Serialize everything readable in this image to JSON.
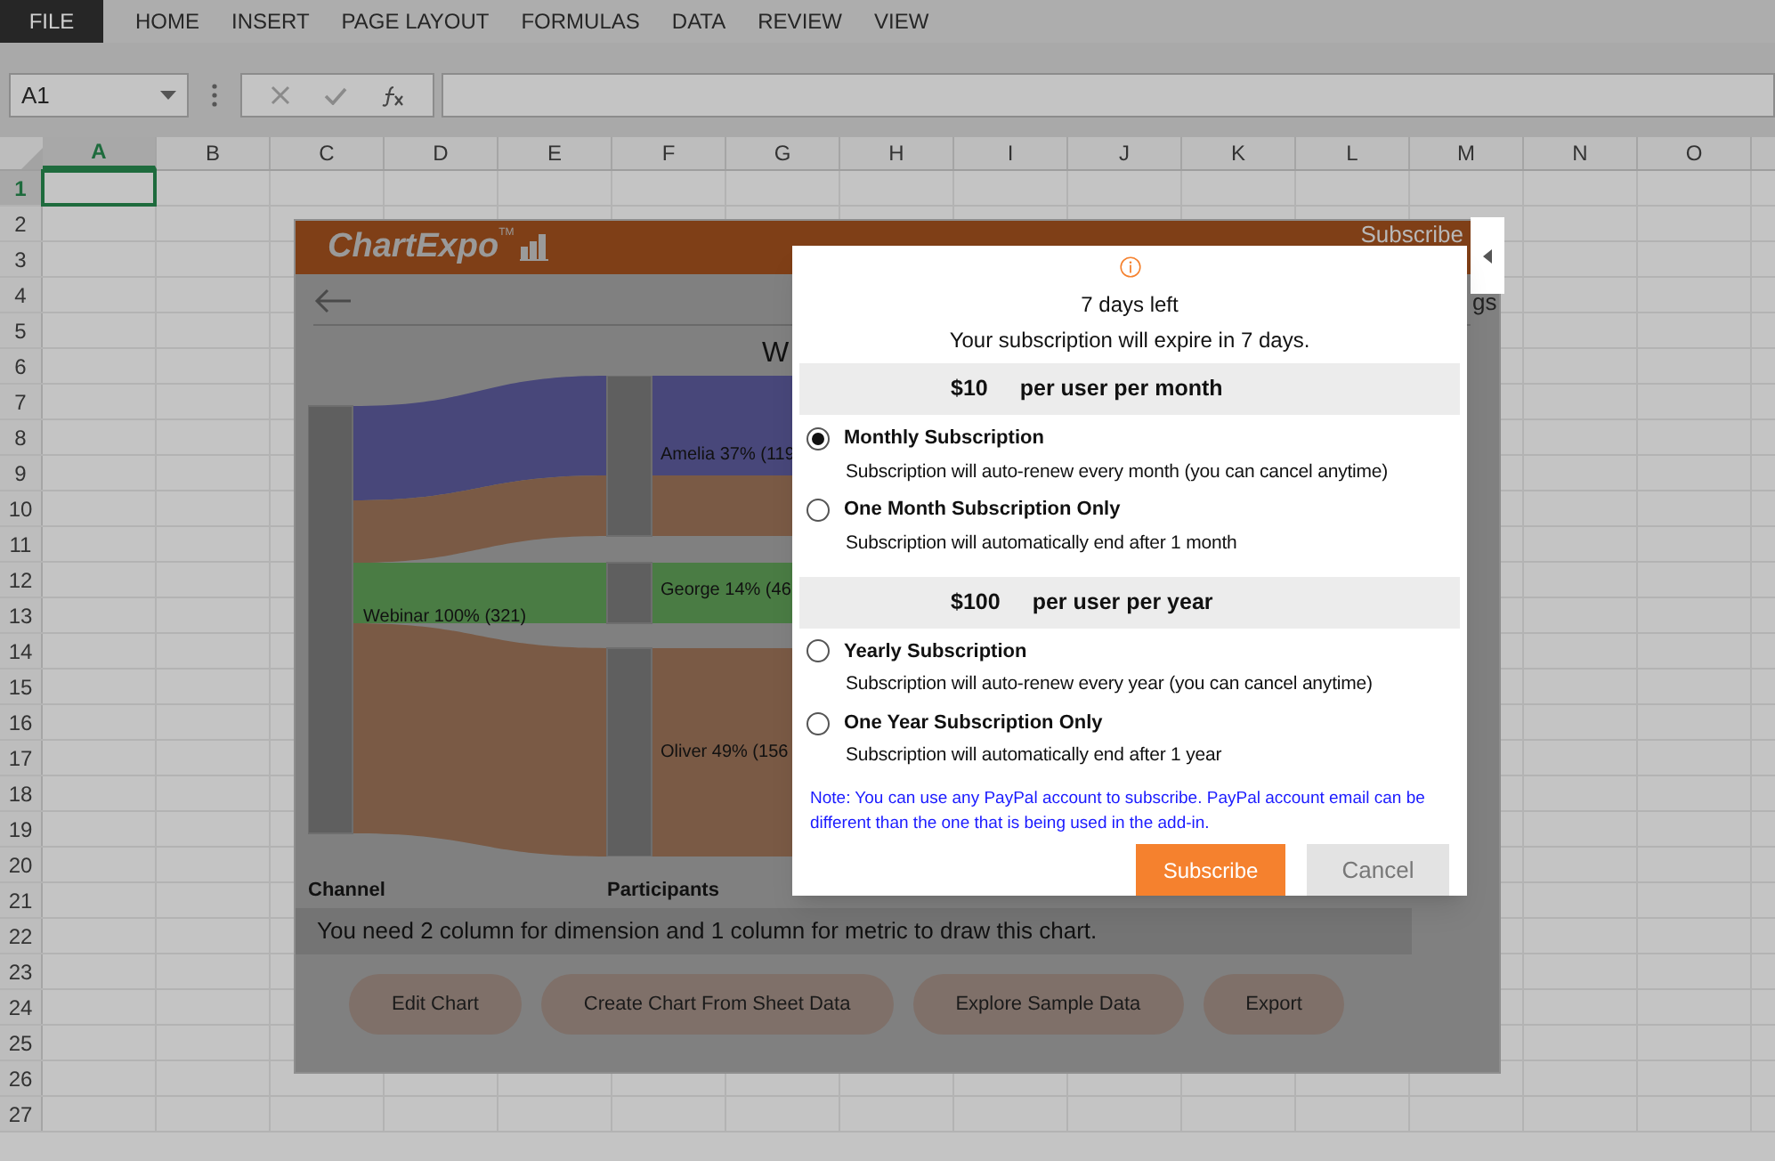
{
  "ribbon_tabs": [
    {
      "label": "FILE",
      "kind": "file"
    },
    {
      "label": "HOME",
      "kind": "tab"
    },
    {
      "label": "INSERT",
      "kind": "tab"
    },
    {
      "label": "PAGE LAYOUT",
      "kind": "tab"
    },
    {
      "label": "FORMULAS",
      "kind": "tab"
    },
    {
      "label": "DATA",
      "kind": "tab"
    },
    {
      "label": "REVIEW",
      "kind": "tab"
    },
    {
      "label": "VIEW",
      "kind": "tab"
    }
  ],
  "name_box": {
    "value": "A1"
  },
  "columns": [
    {
      "label": "A",
      "selected": true
    },
    {
      "label": "B",
      "selected": false
    },
    {
      "label": "C",
      "selected": false
    },
    {
      "label": "D",
      "selected": false
    },
    {
      "label": "E",
      "selected": false
    },
    {
      "label": "F",
      "selected": false
    },
    {
      "label": "G",
      "selected": false
    },
    {
      "label": "H",
      "selected": false
    },
    {
      "label": "I",
      "selected": false
    },
    {
      "label": "J",
      "selected": false
    },
    {
      "label": "K",
      "selected": false
    },
    {
      "label": "L",
      "selected": false
    },
    {
      "label": "M",
      "selected": false
    },
    {
      "label": "N",
      "selected": false
    },
    {
      "label": "O",
      "selected": false
    }
  ],
  "rows": [
    {
      "label": "1",
      "selected": true
    },
    {
      "label": "2",
      "selected": false
    },
    {
      "label": "3",
      "selected": false
    },
    {
      "label": "4",
      "selected": false
    },
    {
      "label": "5",
      "selected": false
    },
    {
      "label": "6",
      "selected": false
    },
    {
      "label": "7",
      "selected": false
    },
    {
      "label": "8",
      "selected": false
    },
    {
      "label": "9",
      "selected": false
    },
    {
      "label": "10",
      "selected": false
    },
    {
      "label": "11",
      "selected": false
    },
    {
      "label": "12",
      "selected": false
    },
    {
      "label": "13",
      "selected": false
    },
    {
      "label": "14",
      "selected": false
    },
    {
      "label": "15",
      "selected": false
    },
    {
      "label": "16",
      "selected": false
    },
    {
      "label": "17",
      "selected": false
    },
    {
      "label": "18",
      "selected": false
    },
    {
      "label": "19",
      "selected": false
    },
    {
      "label": "20",
      "selected": false
    },
    {
      "label": "21",
      "selected": false
    },
    {
      "label": "22",
      "selected": false
    },
    {
      "label": "23",
      "selected": false
    },
    {
      "label": "24",
      "selected": false
    },
    {
      "label": "25",
      "selected": false
    },
    {
      "label": "26",
      "selected": false
    },
    {
      "label": "27",
      "selected": false
    }
  ],
  "addin": {
    "logo": "ChartExpo",
    "logo_trademark": "TM",
    "header_link": "Subscribe",
    "settings_fragment": "gs",
    "chart_title": "W",
    "channel_nodes": [
      {
        "label": "Webinar 100% (321)"
      }
    ],
    "participant_nodes": [
      {
        "label": "Amelia 37% (119"
      },
      {
        "label": "George 14% (46"
      },
      {
        "label": "Oliver 49% (156"
      }
    ],
    "axis_labels": [
      "Channel",
      "Participants"
    ],
    "message": "You need 2 column for dimension and 1 column for metric to draw this chart.",
    "buttons": [
      "Edit Chart",
      "Create Chart From Sheet Data",
      "Explore Sample Data",
      "Export"
    ]
  },
  "dialog": {
    "headline": "7 days left",
    "subtitle": "Your subscription will expire in 7 days.",
    "plans": [
      {
        "price": "$10",
        "period": "per user per month",
        "options": [
          {
            "title": "Monthly Subscription",
            "description": "Subscription will auto-renew every month (you can cancel anytime)",
            "selected": true
          },
          {
            "title": "One Month Subscription Only",
            "description": "Subscription will automatically end after 1 month",
            "selected": false
          }
        ]
      },
      {
        "price": "$100",
        "period": "per user per year",
        "options": [
          {
            "title": "Yearly Subscription",
            "description": "Subscription will auto-renew every year (you can cancel anytime)",
            "selected": false
          },
          {
            "title": "One Year Subscription Only",
            "description": "Subscription will automatically end after 1 year",
            "selected": false
          }
        ]
      }
    ],
    "note": "Note: You can use any PayPal account to subscribe. PayPal account email can be different than the one that is being used in the add-in.",
    "buttons": [
      {
        "label": "Subscribe",
        "kind": "primary"
      },
      {
        "label": "Cancel",
        "kind": "secondary"
      }
    ]
  }
}
